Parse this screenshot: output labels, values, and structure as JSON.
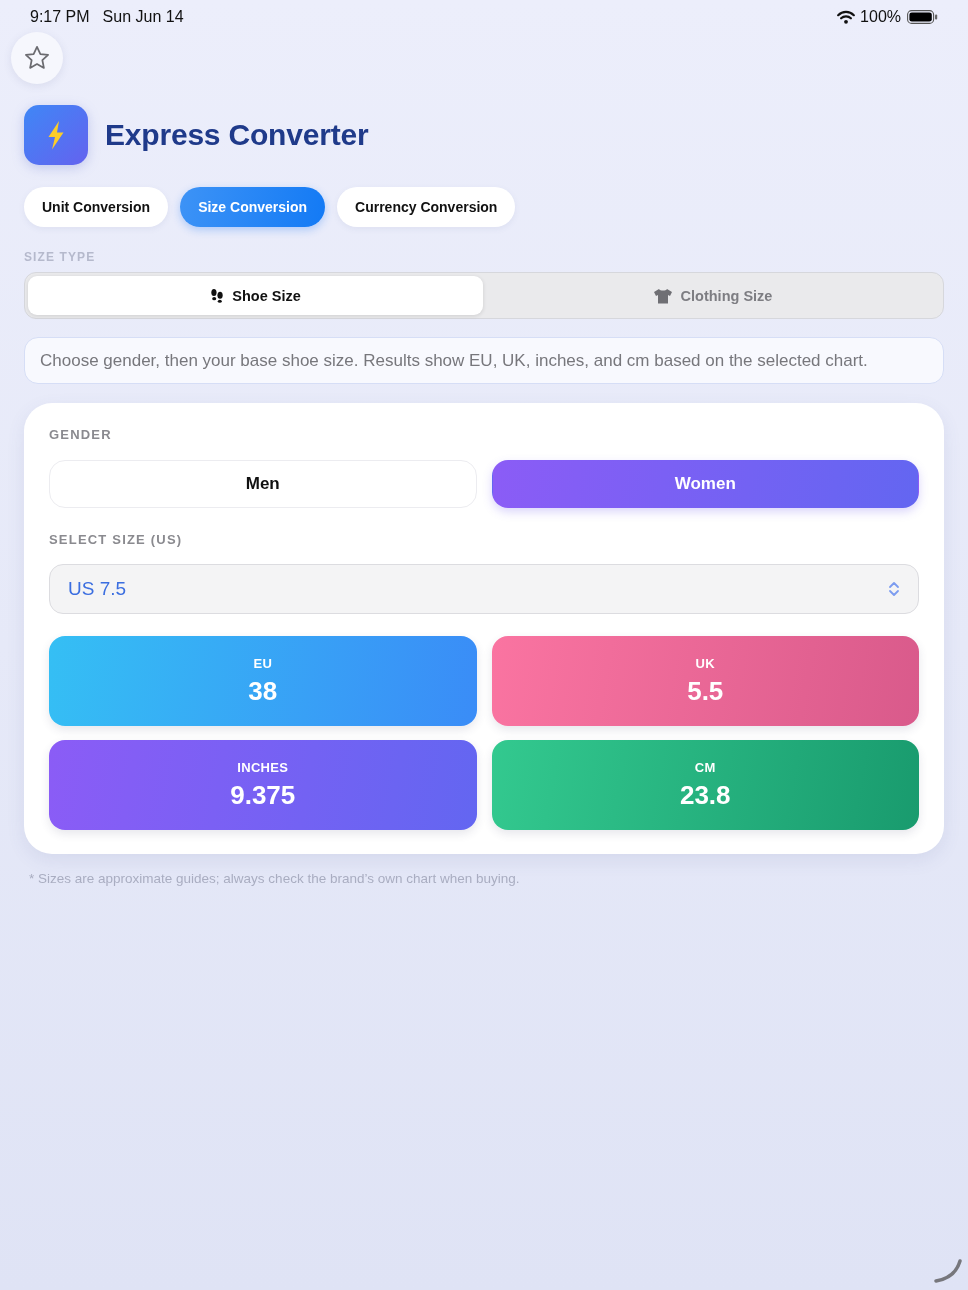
{
  "status_bar": {
    "time": "9:17 PM",
    "date": "Sun Jun 14",
    "battery": "100%"
  },
  "app": {
    "title": "Express Converter"
  },
  "tabs": [
    {
      "label": "Unit Conversion",
      "selected": false
    },
    {
      "label": "Size Conversion",
      "selected": true
    },
    {
      "label": "Currency Conversion",
      "selected": false
    }
  ],
  "size_type": {
    "label": "SIZE TYPE",
    "options": [
      {
        "label": "Shoe Size",
        "kind": "shoe",
        "selected": true
      },
      {
        "label": "Clothing Size",
        "kind": "clothing",
        "selected": false
      }
    ]
  },
  "info": "Choose gender, then your base shoe size. Results show EU, UK, inches, and cm based on the selected chart.",
  "card": {
    "gender_label": "GENDER",
    "genders": [
      {
        "label": "Men",
        "selected": false
      },
      {
        "label": "Women",
        "selected": true
      }
    ],
    "size_label": "SELECT SIZE (US)",
    "size_select": {
      "value": "US 7.5"
    },
    "results": [
      {
        "label": "EU",
        "value": "38"
      },
      {
        "label": "UK",
        "value": "5.5"
      },
      {
        "label": "INCHES",
        "value": "9.375"
      },
      {
        "label": "CM",
        "value": "23.8"
      }
    ]
  },
  "footnote": "* Sizes are approximate guides; always check the brand’s own chart when buying."
}
